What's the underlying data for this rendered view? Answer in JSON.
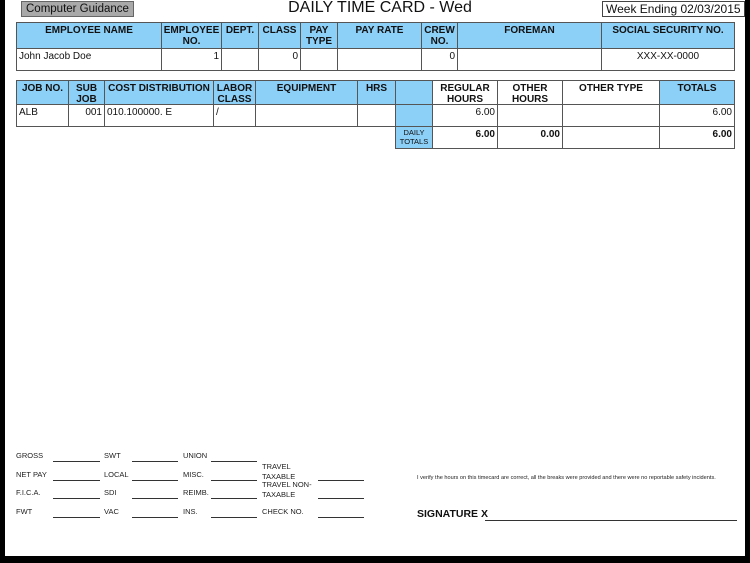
{
  "header": {
    "brand": "Computer Guidance",
    "title": "DAILY TIME CARD - Wed",
    "week_ending": "Week Ending 02/03/2015"
  },
  "employee_table": {
    "columns": [
      "EMPLOYEE NAME",
      "EMPLOYEE NO.",
      "DEPT.",
      "CLASS",
      "PAY TYPE",
      "PAY RATE",
      "CREW NO.",
      "FOREMAN",
      "SOCIAL SECURITY NO."
    ],
    "row": [
      "John Jacob Doe",
      "1",
      "",
      "0",
      "",
      "",
      "0",
      "",
      "XXX-XX-0000"
    ]
  },
  "job_table": {
    "columns": [
      "JOB NO.",
      "SUB JOB",
      "COST DISTRIBUTION",
      "LABOR CLASS",
      "EQUIPMENT",
      "HRS",
      "",
      "REGULAR HOURS",
      "OTHER HOURS",
      "OTHER TYPE",
      "TOTALS"
    ],
    "rows": [
      [
        "ALB",
        "001",
        "010.100000. E",
        "/",
        "",
        "",
        "",
        "6.00",
        "",
        "",
        "6.00"
      ]
    ],
    "daily_totals": {
      "label": "DAILY TOTALS",
      "regular_hours": "6.00",
      "other_hours": "0.00",
      "other_type": "",
      "totals": "6.00"
    }
  },
  "deductions": [
    [
      "GROSS",
      "SWT",
      "UNION",
      ""
    ],
    [
      "NET PAY",
      "LOCAL",
      "MISC.",
      "TRAVEL TAXABLE"
    ],
    [
      "F.I.C.A.",
      "SDI",
      "REIMB.",
      "TRAVEL NON-TAXABLE"
    ],
    [
      "FWT",
      "VAC",
      "INS.",
      "CHECK NO."
    ]
  ],
  "verification": "I verify the hours on this timecard are correct, all the breaks were provided and there were no reportable safety incidents.",
  "signature_label": "SIGNATURE X",
  "colors": {
    "header_blue": "#8ccff7"
  }
}
